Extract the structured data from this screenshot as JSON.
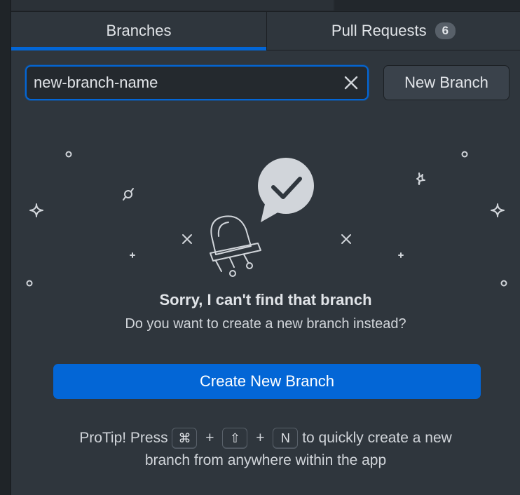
{
  "tabs": [
    {
      "label": "Branches",
      "active": true
    },
    {
      "label": "Pull Requests",
      "count": "6",
      "active": false
    }
  ],
  "search": {
    "value": "new-branch-name",
    "clear_icon": "close-icon"
  },
  "toolbar": {
    "new_branch_label": "New Branch"
  },
  "empty_state": {
    "title": "Sorry, I can't find that branch",
    "subtitle": "Do you want to create a new branch instead?",
    "create_label": "Create New Branch"
  },
  "protip": {
    "prefix": "ProTip! Press",
    "key1": "⌘",
    "plus": "+",
    "key2": "⇧",
    "key3": "N",
    "suffix_line1": "to quickly create a new",
    "line2": "branch from anywhere within the app"
  },
  "colors": {
    "accent": "#0366d6",
    "panel": "#2f363d",
    "background": "#24292e"
  }
}
